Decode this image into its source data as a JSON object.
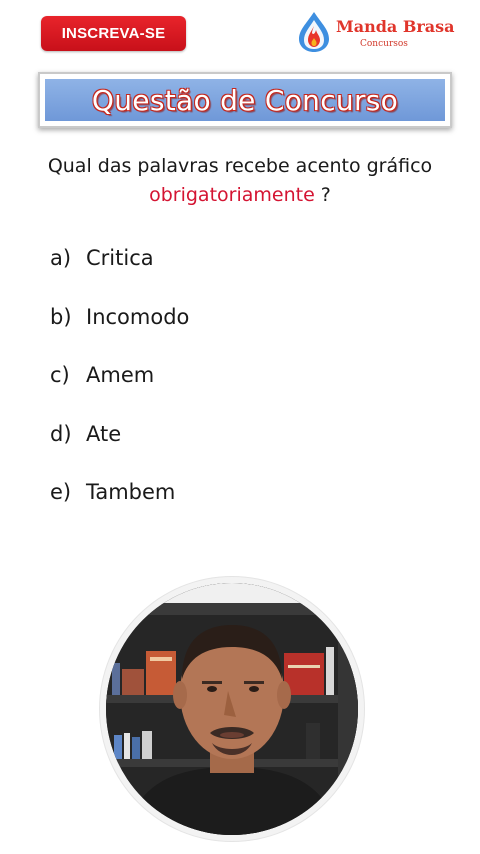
{
  "header": {
    "subscribe_label": "INSCREVA-SE",
    "logo_name": "Manda Brasa",
    "logo_subtitle": "Concursos"
  },
  "title": "Questão de Concurso",
  "question": {
    "text_before": "Qual das palavras recebe acento gráfico ",
    "highlight": "obrigatoriamente",
    "text_after": " ?"
  },
  "options": [
    {
      "letter": "a)",
      "text": "Critica"
    },
    {
      "letter": "b)",
      "text": "Incomodo"
    },
    {
      "letter": "c)",
      "text": "Amem"
    },
    {
      "letter": "d)",
      "text": "Ate"
    },
    {
      "letter": "e)",
      "text": "Tambem"
    }
  ],
  "colors": {
    "subscribe_button": "#d41a22",
    "title_background": "#7ea6e0",
    "title_outline": "#c4281f",
    "highlight_text": "#d41432"
  },
  "icons": {
    "logo": "flame-drop-icon"
  }
}
